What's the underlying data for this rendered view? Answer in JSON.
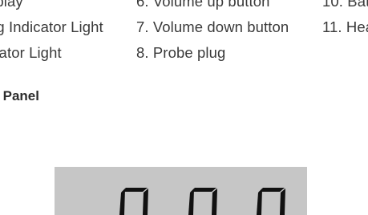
{
  "parts_list": {
    "rows": [
      [
        "splay",
        "6. Volume up button",
        "10. Bat"
      ],
      [
        "ng Indicator Light",
        "7. Volume down button",
        "11. Hea"
      ],
      [
        "icator Light",
        "8. Probe plug",
        ""
      ]
    ]
  },
  "section": {
    "heading": "ay Panel"
  },
  "display_panel": {
    "digit_count": 3,
    "background_color": "#c6c6c6",
    "segment_color": "#111111"
  }
}
